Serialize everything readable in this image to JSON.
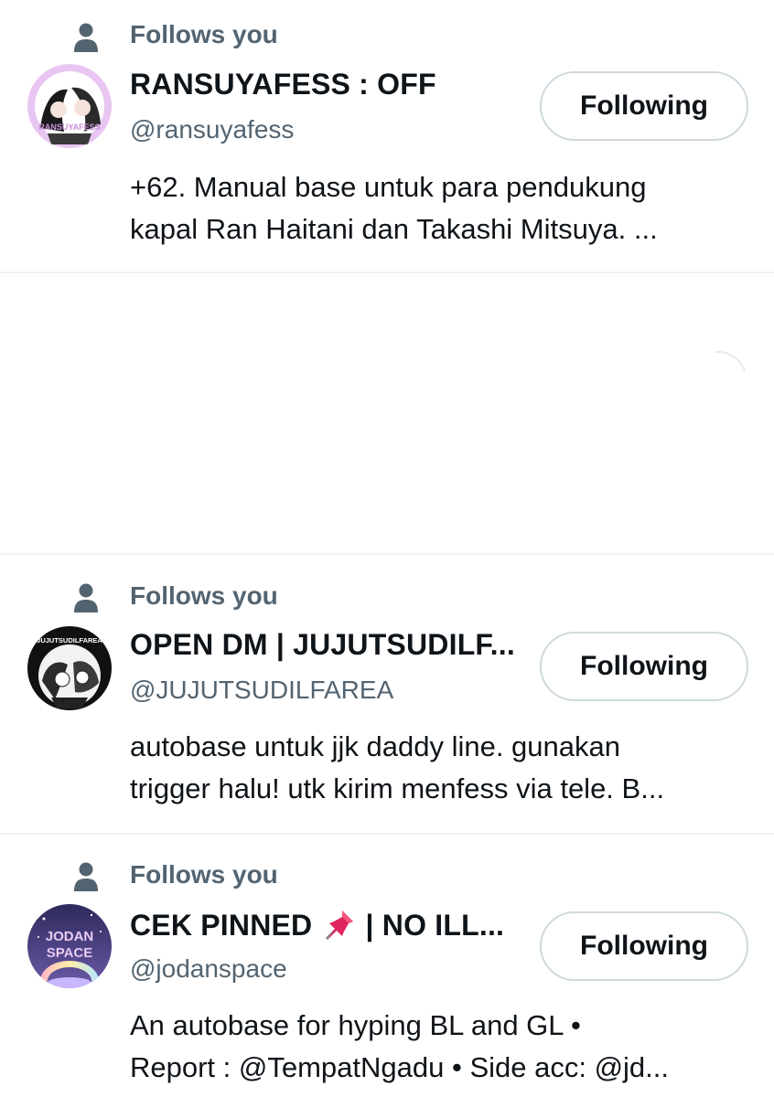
{
  "accounts": [
    {
      "follows_label": "Follows you",
      "display_name": "RANSUYAFESS : OFF",
      "handle": "@ransuyafess",
      "button_label": "Following",
      "bio_line1": "+62. Manual base untuk para pendukung",
      "bio_line2": "kapal Ran Haitani dan Takashi Mitsuya. ...",
      "avatar_text": "RANSUYAFESS",
      "avatar_icon": "anime-duo-avatar"
    },
    {
      "follows_label": "Follows you",
      "display_name": "OPEN DM | JUJUTSUDILF...",
      "handle": "@JUJUTSUDILFAREA",
      "button_label": "Following",
      "bio_line1": "autobase untuk jjk daddy line. gunakan",
      "bio_line2": "trigger halu! utk kirim menfess via tele. B...",
      "avatar_text": "JUJUTSUDILFAREA",
      "avatar_icon": "manga-collage-avatar"
    },
    {
      "follows_label": "Follows you",
      "display_name_part1": "CEK PINNED",
      "display_name_icon": "pushpin-emoji",
      "display_name_part2": "| NO ILL...",
      "handle": "@jodanspace",
      "button_label": "Following",
      "bio_line1": "An autobase for hyping BL and GL •",
      "bio_line2": "Report : @TempatNgadu • Side acc: @jd...",
      "avatar_text_line1": "JODAN",
      "avatar_text_line2": "SPACE",
      "avatar_icon": "jodan-space-avatar"
    }
  ],
  "colors": {
    "primary_text": "#0f1419",
    "secondary_text": "#536471",
    "divider": "#eff3f4",
    "button_border": "#cfd9de"
  }
}
